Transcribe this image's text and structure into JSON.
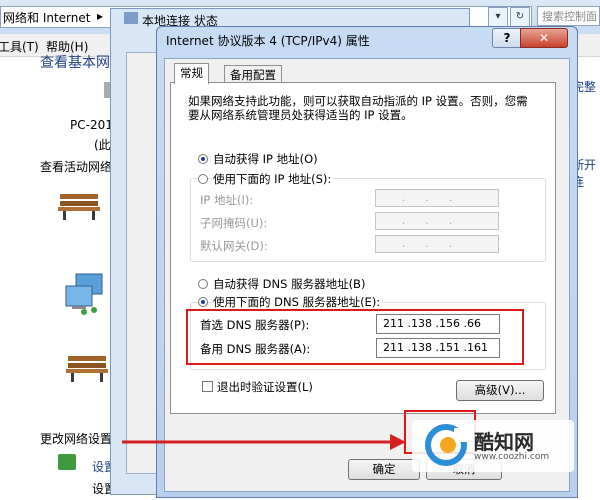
{
  "explorer": {
    "breadcrumb": "网络和 Internet",
    "search_placeholder": "搜索控制面",
    "menu_tools": "工具(T)",
    "menu_help": "帮助(H)",
    "view_basic": "查看基本网",
    "pc_name": "PC-201",
    "pc_sub": "(此",
    "view_active": "查看活动网络",
    "change_settings": "更改网络设置",
    "setup_new": "设置新",
    "setup_none": "设置无",
    "right_complete": "完整",
    "right_disconnect": "断开连"
  },
  "middle_dialog": {
    "title": "本地连接 状态"
  },
  "dialog": {
    "title": "Internet 协议版本 4 (TCP/IPv4) 属性",
    "help_glyph": "?",
    "close_glyph": "✕",
    "tabs": [
      "常规",
      "备用配置"
    ],
    "description": "如果网络支持此功能，则可以获取自动指派的 IP 设置。否则，您需要从网络系统管理员处获得适当的 IP 设置。",
    "ip_auto": "自动获得 IP 地址(O)",
    "ip_manual": "使用下面的 IP 地址(S):",
    "ip_address_label": "IP 地址(I):",
    "subnet_label": "子网掩码(U):",
    "gateway_label": "默认网关(D):",
    "ip_dots": "...",
    "dns_auto": "自动获得 DNS 服务器地址(B)",
    "dns_manual": "使用下面的 DNS 服务器地址(E):",
    "preferred_dns_label": "首选 DNS 服务器(P):",
    "preferred_dns_value": "211 .138 .156 .66",
    "alternate_dns_label": "备用 DNS 服务器(A):",
    "alternate_dns_value": "211 .138 .151 .161",
    "validate_label": "退出时验证设置(L)",
    "advanced_button": "高级(V)...",
    "ok_button": "确定",
    "cancel_button": "取消",
    "selected_ip_mode": "auto",
    "selected_dns_mode": "manual",
    "validate_checked": false
  },
  "watermark": {
    "brand": "酷知网",
    "url": "www.coozhi.com"
  },
  "colors": {
    "highlight_red": "#e01818",
    "arrow_red": "#d62020",
    "link_blue": "#1e3f85"
  }
}
